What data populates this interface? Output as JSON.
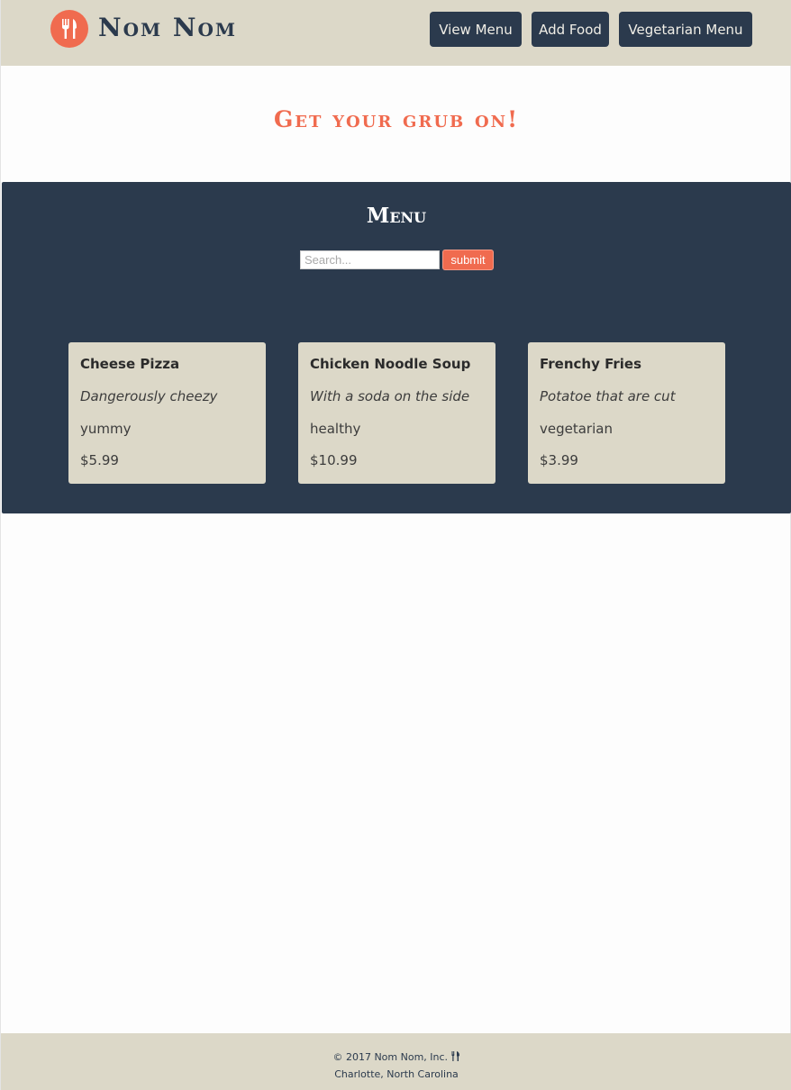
{
  "header": {
    "brand": "Nom Nom",
    "nav": [
      {
        "label": "View Menu"
      },
      {
        "label": "Add Food"
      },
      {
        "label": "Vegetarian Menu"
      }
    ]
  },
  "tagline": "Get your grub on!",
  "menu": {
    "title": "Menu",
    "search": {
      "placeholder": "Search...",
      "value": ""
    },
    "submit_label": "submit",
    "items": [
      {
        "name": "Cheese Pizza",
        "description": "Dangerously cheezy",
        "tag": "yummy",
        "price": "$5.99"
      },
      {
        "name": "Chicken Noodle Soup",
        "description": "With a soda on the side",
        "tag": "healthy",
        "price": "$10.99"
      },
      {
        "name": "Frenchy Fries",
        "description": "Potatoe that are cut",
        "tag": "vegetarian",
        "price": "$3.99"
      }
    ]
  },
  "footer": {
    "copyright": "© 2017 Nom Nom, Inc.",
    "location": "Charlotte, North Carolina"
  },
  "colors": {
    "accent": "#f06b4f",
    "navy": "#2b3a4d",
    "beige": "#dcd8c8"
  },
  "icons": {
    "logo": "fork-knife-icon",
    "footer": "fork-knife-icon"
  }
}
